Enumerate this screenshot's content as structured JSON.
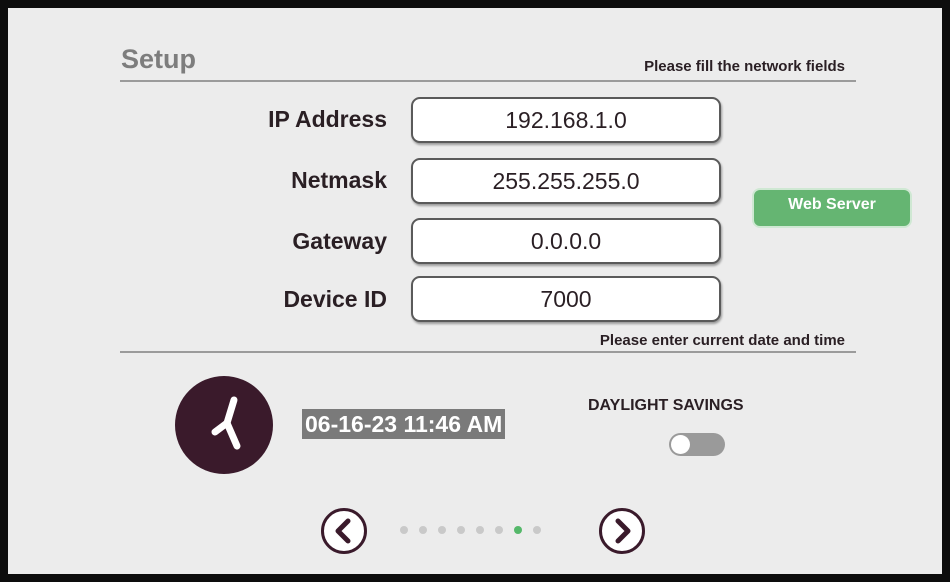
{
  "header": {
    "title": "Setup",
    "network_hint": "Please fill the network fields"
  },
  "network": {
    "fields": [
      {
        "label": "IP Address",
        "value": "192.168.1.0"
      },
      {
        "label": "Netmask",
        "value": "255.255.255.0"
      },
      {
        "label": "Gateway",
        "value": "0.0.0.0"
      },
      {
        "label": "Device ID",
        "value": "7000"
      }
    ],
    "web_server_label": "Web Server"
  },
  "datetime": {
    "hint": "Please enter current date and time",
    "value": "06-16-23 11:46 AM",
    "clock_icon": "clock-icon",
    "daylight_savings_label": "DAYLIGHT SAVINGS",
    "daylight_savings_enabled": false
  },
  "pagination": {
    "prev_icon": "chevron-left-icon",
    "next_icon": "chevron-right-icon",
    "page_count": 8,
    "current_page": 7
  },
  "colors": {
    "accent_green": "#65b572",
    "dark_plum": "#3a1a2b",
    "background": "#ececec"
  }
}
